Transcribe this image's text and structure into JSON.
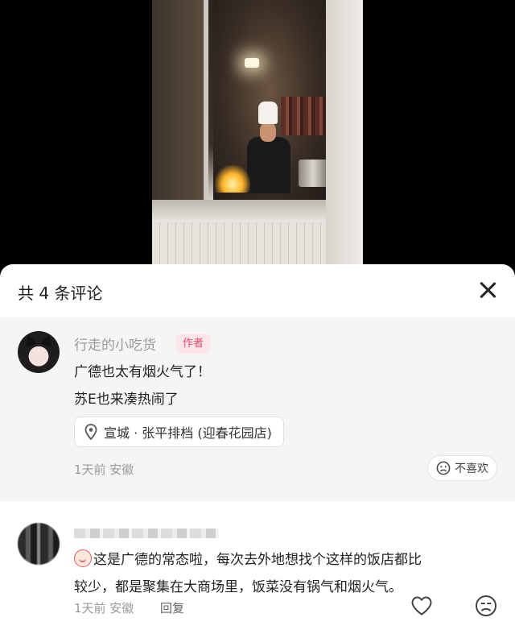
{
  "sheet": {
    "title": "共 4 条评论",
    "close_icon": "close-icon"
  },
  "comments": [
    {
      "author": "行走的小吃货",
      "badge": "作者",
      "lines": [
        "广德也太有烟火气了！",
        "苏E也来凑热闹了"
      ],
      "location": "宣城 · 张平排档 (迎春花园店)",
      "location_icon": "location-pin-icon",
      "meta": "1天前 安徽",
      "dislike_label": "不喜欢",
      "dislike_icon": "unhappy-face-icon"
    },
    {
      "reaction_icon": "crying-face-emoji",
      "lines": [
        "这是广德的常态啦，每次去外地想找个这样的饭店都比",
        "较少，都是聚集在大商场里，饭菜没有锅气和烟火气。"
      ],
      "meta": "1天前 安徽",
      "reply_label": "回复",
      "like_icon": "heart-icon",
      "dislike_icon": "unhappy-face-icon"
    }
  ],
  "colors": {
    "badge_bg": "#fde6ea",
    "badge_text": "#e8486a",
    "highlight_bg": "#f5f5f5"
  }
}
